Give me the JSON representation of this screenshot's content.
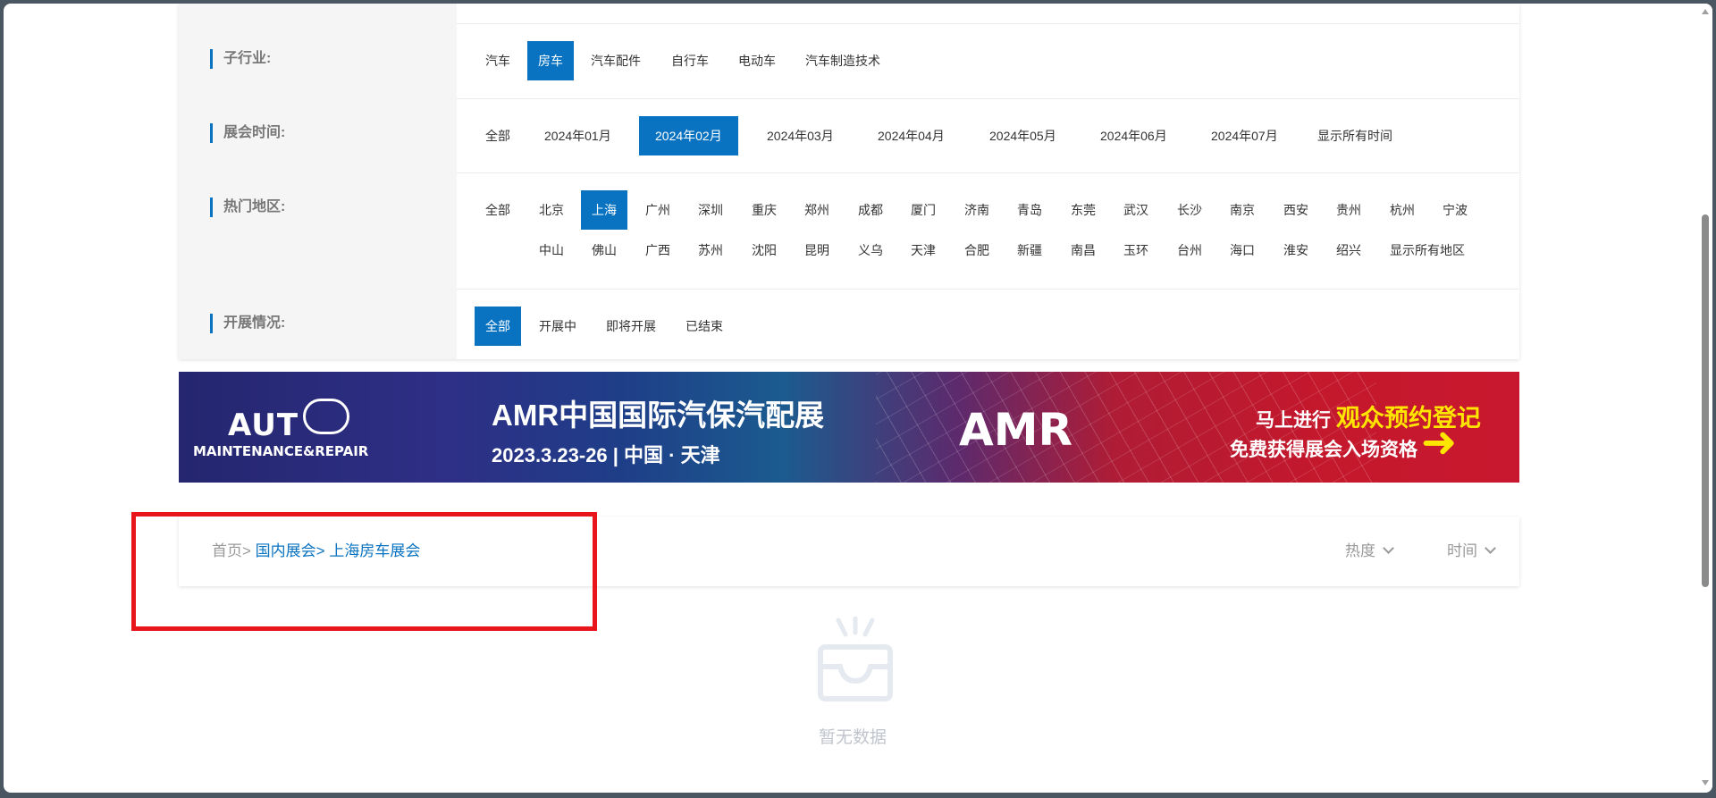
{
  "filters": {
    "sub_industry": {
      "label": "子行业:",
      "options": [
        "汽车",
        "房车",
        "汽车配件",
        "自行车",
        "电动车",
        "汽车制造技术"
      ],
      "active": "房车"
    },
    "exhibition_time": {
      "label": "展会时间:",
      "options": [
        "全部",
        "2024年01月",
        "2024年02月",
        "2024年03月",
        "2024年04月",
        "2024年05月",
        "2024年06月",
        "2024年07月",
        "显示所有时间"
      ],
      "active": "2024年02月"
    },
    "hot_region": {
      "label": "热门地区:",
      "row1": [
        "全部",
        "北京",
        "上海",
        "广州",
        "深圳",
        "重庆",
        "郑州",
        "成都",
        "厦门",
        "济南",
        "青岛",
        "东莞",
        "武汉",
        "长沙",
        "南京",
        "西安",
        "贵州",
        "杭州",
        "宁波"
      ],
      "row2": [
        "中山",
        "佛山",
        "广西",
        "苏州",
        "沈阳",
        "昆明",
        "义乌",
        "天津",
        "合肥",
        "新疆",
        "南昌",
        "玉环",
        "台州",
        "海口",
        "淮安",
        "绍兴",
        "显示所有地区"
      ],
      "active": "上海"
    },
    "status": {
      "label": "开展情况:",
      "options": [
        "全部",
        "开展中",
        "即将开展",
        "已结束"
      ],
      "active": "全部"
    }
  },
  "banner": {
    "logo_main": "AUT",
    "logo_sub": "MAINTENANCE&REPAIR",
    "title": "AMR中国国际汽保汽配展",
    "date": "2023.3.23-26 | 中国 · 天津",
    "brand": "AMR",
    "cta_prefix": "马上进行",
    "cta_highlight": "观众预约登记",
    "cta_line2": "免费获得展会入场资格",
    "colors": {
      "accent": "#ffe600",
      "left": "#2e2f86",
      "right": "#c8182f"
    }
  },
  "breadcrumb": {
    "home": "首页>",
    "level1": "国内展会>",
    "level2": "上海房车展会"
  },
  "sort": {
    "popularity": "热度",
    "time": "时间"
  },
  "empty": {
    "text": "暂无数据"
  },
  "colors": {
    "primary": "#0a73c1",
    "highlight_border": "#e8161b"
  }
}
